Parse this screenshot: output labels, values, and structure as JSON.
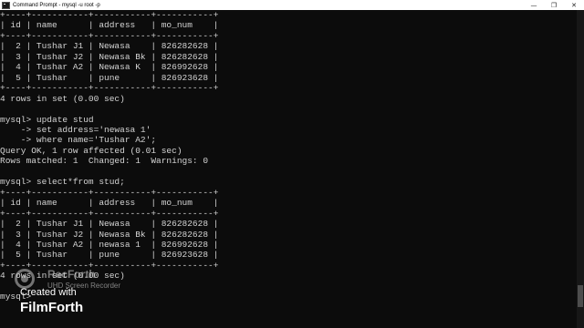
{
  "window": {
    "title": "Command Prompt - mysql -u root -p",
    "app_icon": "cmd-icon",
    "controls": {
      "minimize": "—",
      "maximize": "❐",
      "close": "✕"
    }
  },
  "console": {
    "lines": [
      "+----+-----------+-----------+-----------+",
      "| id | name      | address   | mo_num    |",
      "+----+-----------+-----------+-----------+",
      "|  2 | Tushar J1 | Newasa    | 826282628 |",
      "|  3 | Tushar J2 | Newasa Bk | 826282628 |",
      "|  4 | Tushar A2 | Newasa K  | 826992628 |",
      "|  5 | Tushar    | pune      | 826923628 |",
      "+----+-----------+-----------+-----------+",
      "4 rows in set (0.00 sec)",
      "",
      "mysql> update stud",
      "    -> set address='newasa 1'",
      "    -> where name='Tushar A2';",
      "Query OK, 1 row affected (0.01 sec)",
      "Rows matched: 1  Changed: 1  Warnings: 0",
      "",
      "mysql> select*from stud;",
      "+----+-----------+-----------+-----------+",
      "| id | name      | address   | mo_num    |",
      "+----+-----------+-----------+-----------+",
      "|  2 | Tushar J1 | Newasa    | 826282628 |",
      "|  3 | Tushar J2 | Newasa Bk | 826282628 |",
      "|  4 | Tushar A2 | newasa 1  | 826992628 |",
      "|  5 | Tushar    | pune      | 826923628 |",
      "+----+-----------+-----------+-----------+",
      "4 rows in set (0.00 sec)",
      "",
      "mysql> "
    ]
  },
  "scrollbar": {
    "position": 0.93,
    "visible_fraction": 0.07
  },
  "watermark": {
    "brand": "RecForth",
    "subtitle": "UHD Screen Recorder",
    "created_with": "Created with",
    "product": "FilmForth"
  }
}
